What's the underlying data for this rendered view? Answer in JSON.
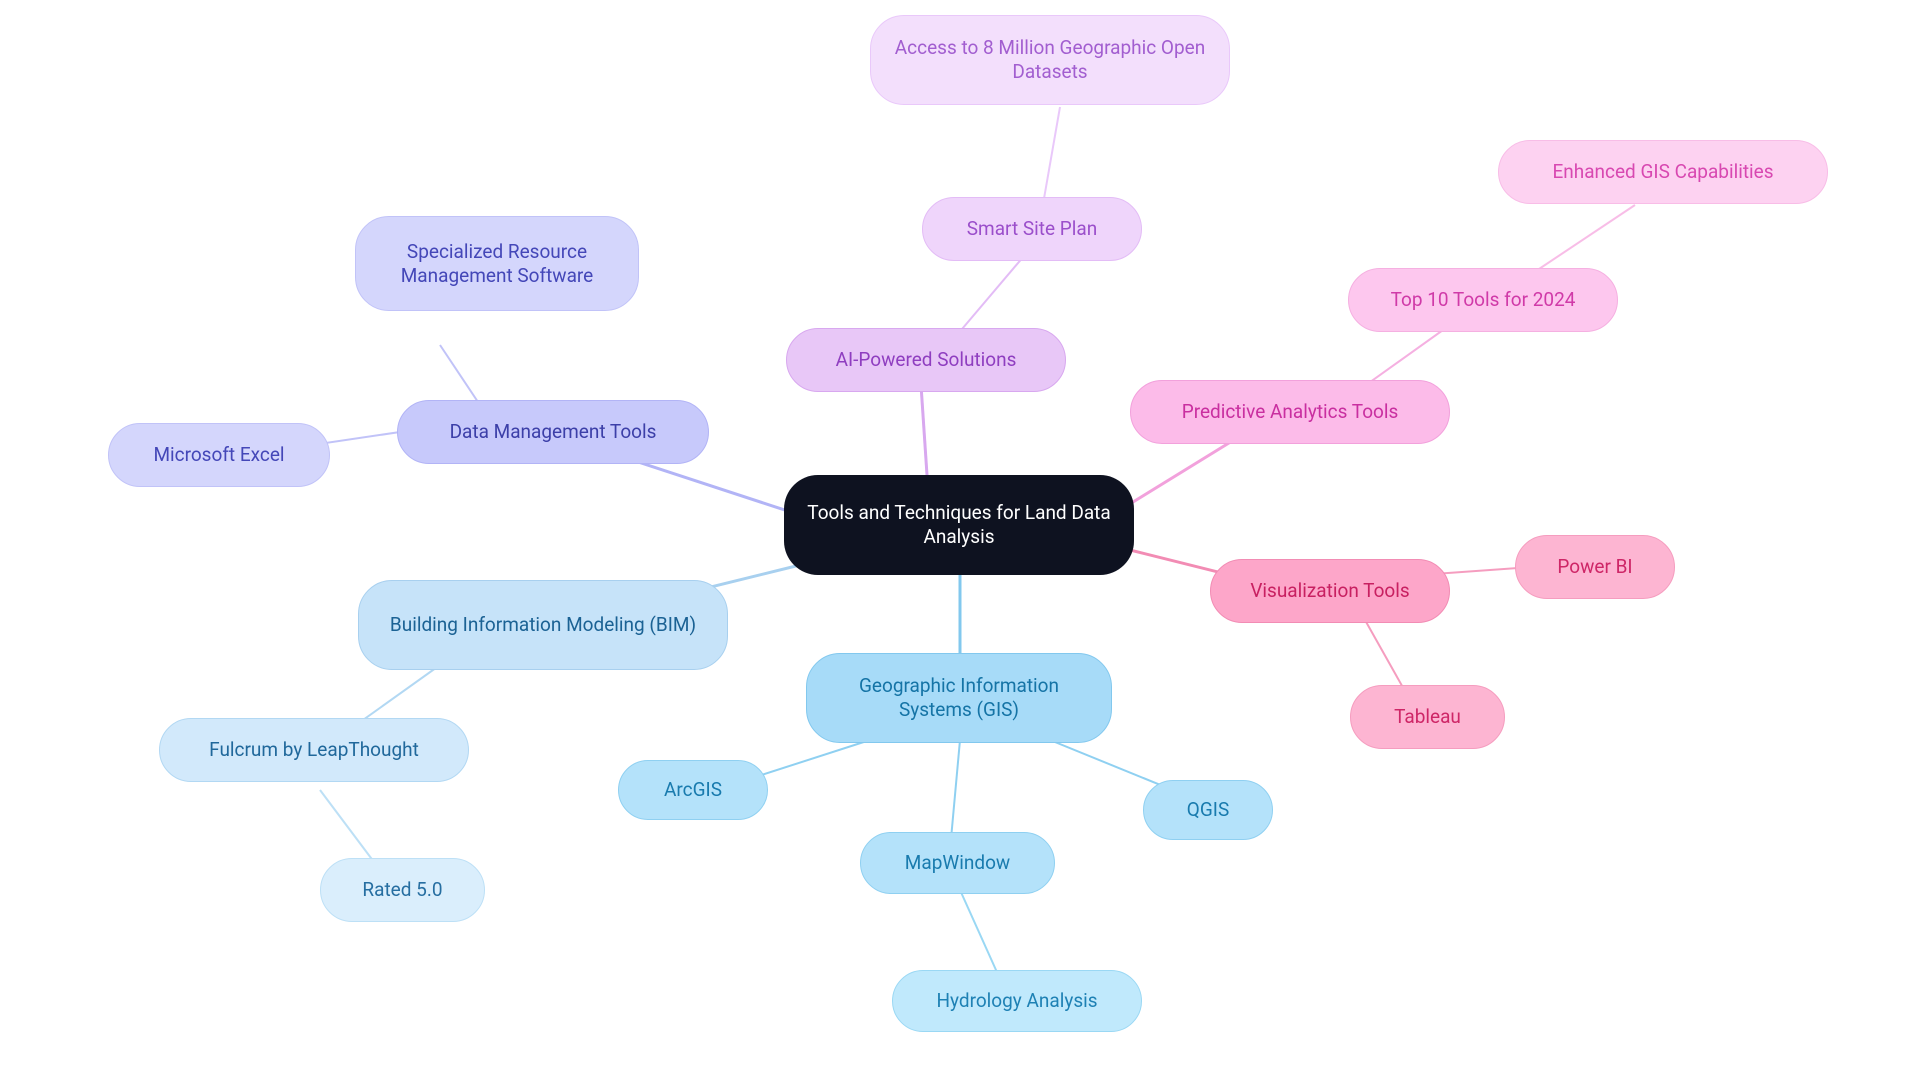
{
  "root": {
    "label": "Tools and Techniques for Land Data Analysis"
  },
  "branches": {
    "ai": {
      "label": "AI-Powered Solutions",
      "children": {
        "smart_site": {
          "label": "Smart Site Plan",
          "children": {
            "datasets": {
              "label": "Access to 8 Million Geographic Open Datasets"
            }
          }
        }
      }
    },
    "dm": {
      "label": "Data Management Tools",
      "children": {
        "excel": {
          "label": "Microsoft Excel"
        },
        "specialized": {
          "label": "Specialized Resource Management Software"
        }
      }
    },
    "pa": {
      "label": "Predictive Analytics Tools",
      "children": {
        "top10": {
          "label": "Top 10 Tools for 2024",
          "children": {
            "enhanced_gis": {
              "label": "Enhanced GIS Capabilities"
            }
          }
        }
      }
    },
    "vz": {
      "label": "Visualization Tools",
      "children": {
        "powerbi": {
          "label": "Power BI"
        },
        "tableau": {
          "label": "Tableau"
        }
      }
    },
    "bim": {
      "label": "Building Information Modeling (BIM)",
      "children": {
        "fulcrum": {
          "label": "Fulcrum by LeapThought",
          "children": {
            "rated": {
              "label": "Rated 5.0"
            }
          }
        }
      }
    },
    "gis": {
      "label": "Geographic Information Systems (GIS)",
      "children": {
        "arcgis": {
          "label": "ArcGIS"
        },
        "qgis": {
          "label": "QGIS"
        },
        "mapwindow": {
          "label": "MapWindow",
          "children": {
            "hydrology": {
              "label": "Hydrology Analysis"
            }
          }
        }
      }
    }
  }
}
